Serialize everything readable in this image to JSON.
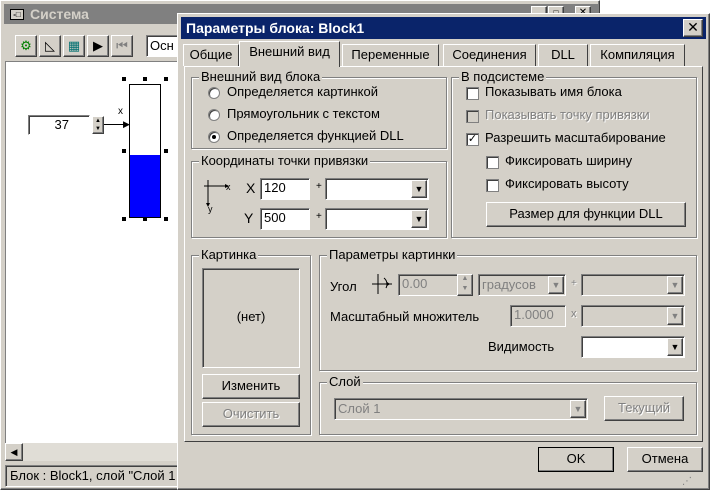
{
  "bg_window": {
    "title": "Система",
    "toolbar_combo_text": "Осн",
    "block_value": "37",
    "x_label": "x",
    "status_text": "Блок : Block1, слой \"Слой 1"
  },
  "dialog": {
    "title": "Параметры блока: Block1",
    "close_label": "✕",
    "tabs": [
      {
        "label": "Общие"
      },
      {
        "label": "Внешний вид"
      },
      {
        "label": "Переменные"
      },
      {
        "label": "Соединения"
      },
      {
        "label": "DLL"
      },
      {
        "label": "Компиляция"
      }
    ],
    "appearance": {
      "title": "Внешний вид блока",
      "options": [
        "Определяется картинкой",
        "Прямоугольник с текстом",
        "Определяется функцией DLL"
      ],
      "selected_index": 2
    },
    "anchor": {
      "title": "Координаты точки привязки",
      "x_label": "X",
      "x_value": "120",
      "y_label": "Y",
      "y_value": "500",
      "plus": "+",
      "axis_x": "x",
      "axis_y": "y"
    },
    "subsystem": {
      "title": "В подсистеме",
      "show_name": "Показывать имя блока",
      "show_anchor": "Показывать точку привязки",
      "allow_scale": "Разрешить масштабирование",
      "fix_width": "Фиксировать ширину",
      "fix_height": "Фиксировать высоту",
      "dll_size_button": "Размер для функции DLL"
    },
    "picture": {
      "title": "Картинка",
      "preview_text": "(нет)",
      "change_button": "Изменить",
      "clear_button": "Очистить"
    },
    "picture_params": {
      "title": "Параметры картинки",
      "angle_label": "Угол",
      "angle_value": "0.00",
      "angle_unit": "градусов",
      "plus": "+",
      "scale_label": "Масштабный множитель",
      "scale_value": "1.0000",
      "times": "x",
      "visibility_label": "Видимость"
    },
    "layer": {
      "title": "Слой",
      "value": "Слой 1",
      "current_button": "Текущий"
    },
    "ok_button": "OK",
    "cancel_button": "Отмена"
  }
}
